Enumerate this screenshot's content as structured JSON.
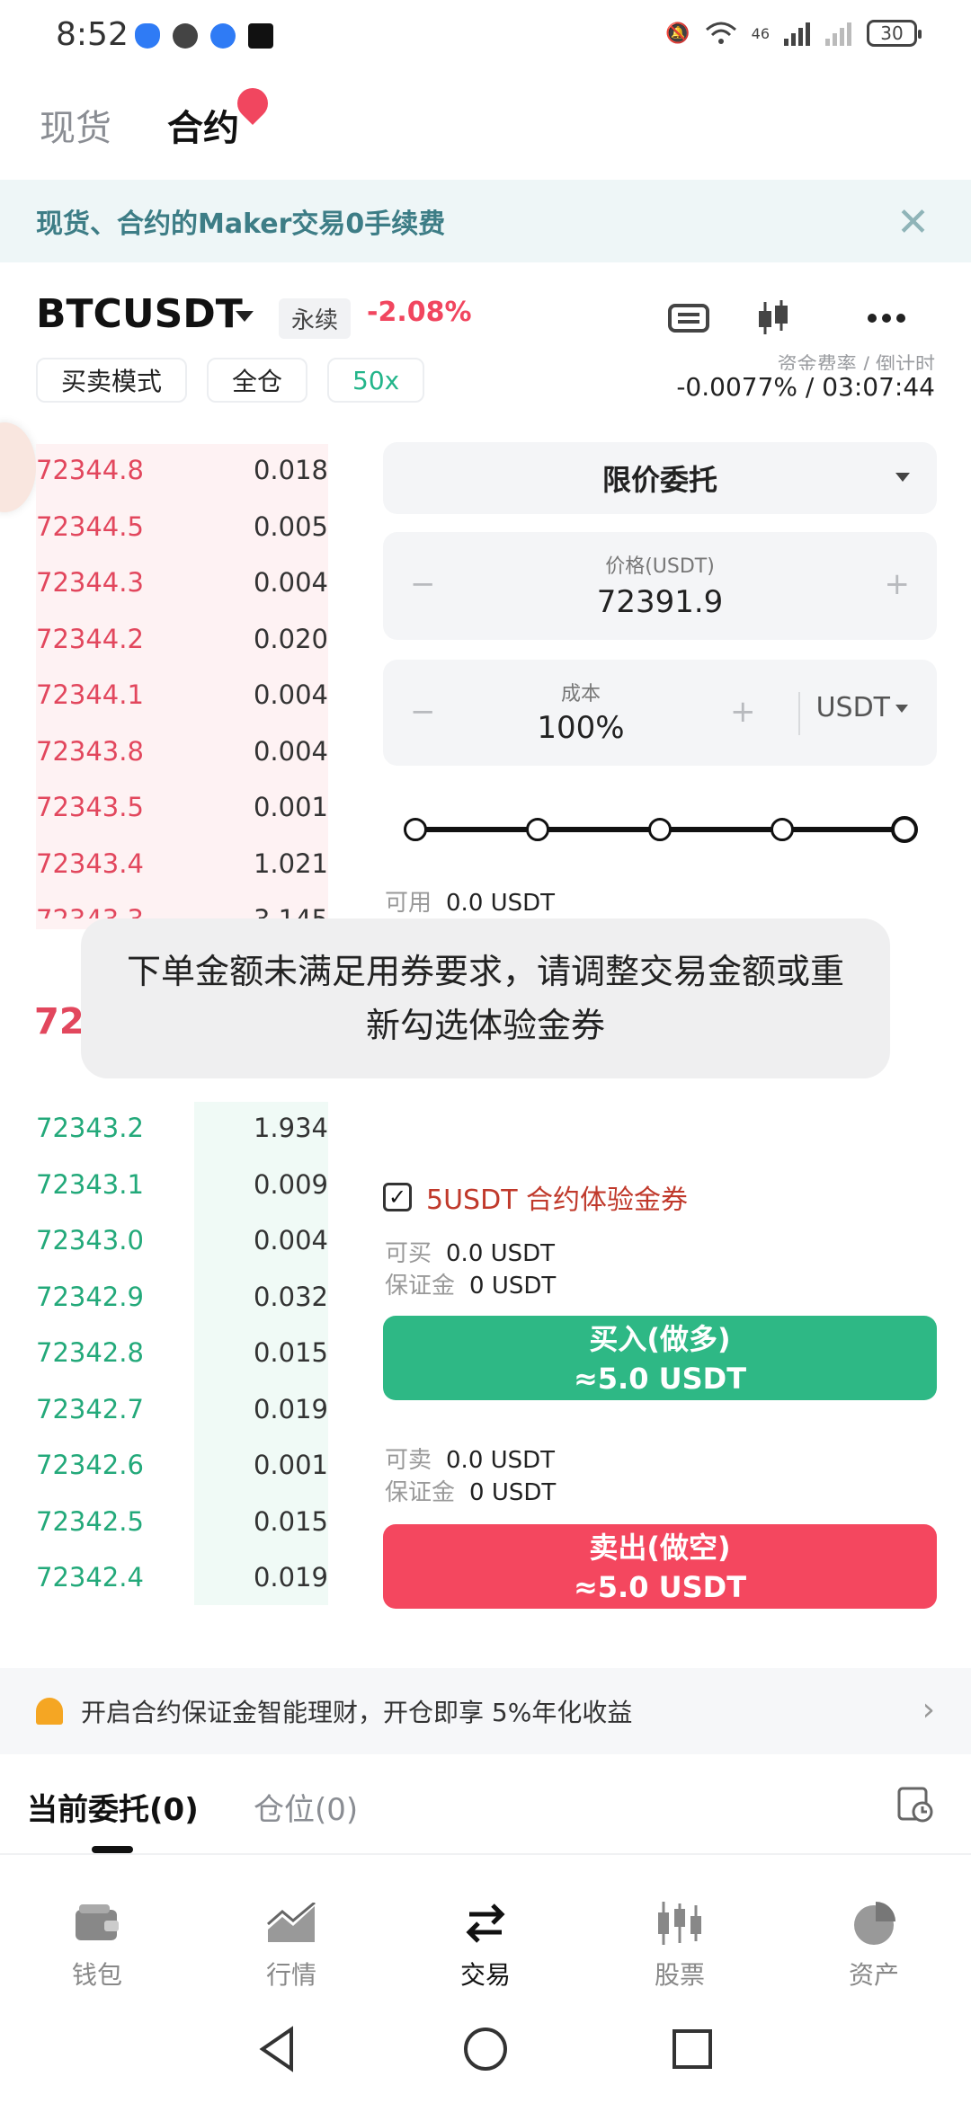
{
  "status": {
    "time": "8:52",
    "battery": "30",
    "network": "46"
  },
  "top_tabs": {
    "spot": "现货",
    "contract": "合约"
  },
  "banner": {
    "text": "现货、合约的Maker交易0手续费"
  },
  "ticker": {
    "symbol": "BTCUSDT",
    "tag": "永续",
    "change": "-2.08%"
  },
  "mode": {
    "trade_mode": "买卖模式",
    "margin_mode": "全仓",
    "leverage": "50x"
  },
  "funding": {
    "label": "资金费率 / 倒计时",
    "value": "-0.0077% / 03:07:44"
  },
  "asks": [
    {
      "price": "72344.8",
      "qty": "0.018"
    },
    {
      "price": "72344.5",
      "qty": "0.005"
    },
    {
      "price": "72344.3",
      "qty": "0.004"
    },
    {
      "price": "72344.2",
      "qty": "0.020"
    },
    {
      "price": "72344.1",
      "qty": "0.004"
    },
    {
      "price": "72343.8",
      "qty": "0.004"
    },
    {
      "price": "72343.5",
      "qty": "0.001"
    },
    {
      "price": "72343.4",
      "qty": "1.021"
    },
    {
      "price": "72343.3",
      "qty": "3.145"
    }
  ],
  "mid_price": "72",
  "bids": [
    {
      "price": "72343.2",
      "qty": "1.934"
    },
    {
      "price": "72343.1",
      "qty": "0.009"
    },
    {
      "price": "72343.0",
      "qty": "0.004"
    },
    {
      "price": "72342.9",
      "qty": "0.032"
    },
    {
      "price": "72342.8",
      "qty": "0.015"
    },
    {
      "price": "72342.7",
      "qty": "0.019"
    },
    {
      "price": "72342.6",
      "qty": "0.001"
    },
    {
      "price": "72342.5",
      "qty": "0.015"
    },
    {
      "price": "72342.4",
      "qty": "0.019"
    }
  ],
  "order_form": {
    "order_type": "限价委托",
    "price_label": "价格(USDT)",
    "price_value": "72391.9",
    "cost_label": "成本",
    "cost_value": "100%",
    "cost_unit": "USDT",
    "minus": "−",
    "plus": "+",
    "available_label": "可用",
    "available_value": "0.0 USDT",
    "slider_level": 1.0
  },
  "toast": {
    "text": "下单金额未满足用券要求，请调整交易金额或重新勾选体验金券"
  },
  "coupon": {
    "label": "5USDT 合约体验金券",
    "check": "✓"
  },
  "buy": {
    "can_label": "可买",
    "can_value": "0.0 USDT",
    "margin_label": "保证金",
    "margin_value": "0 USDT",
    "button_line1": "买入(做多)",
    "button_line2": "≈5.0 USDT"
  },
  "sell": {
    "can_label": "可卖",
    "can_value": "0.0 USDT",
    "margin_label": "保证金",
    "margin_value": "0 USDT",
    "button_line1": "卖出(做空)",
    "button_line2": "≈5.0 USDT"
  },
  "earn": {
    "text": "开启合约保证金智能理财，开仓即享 5%年化收益",
    "arrow": "›"
  },
  "order_tabs": {
    "current": "当前委托(0)",
    "positions": "仓位(0)"
  },
  "nav": [
    {
      "label": "钱包",
      "icon": "wallet-icon"
    },
    {
      "label": "行情",
      "icon": "chart-icon"
    },
    {
      "label": "交易",
      "icon": "swap-icon"
    },
    {
      "label": "股票",
      "icon": "stocks-icon"
    },
    {
      "label": "资产",
      "icon": "pie-icon"
    }
  ],
  "colors": {
    "red": "#f4475f",
    "green": "#2eb885",
    "teal_text": "#3d7d86"
  }
}
